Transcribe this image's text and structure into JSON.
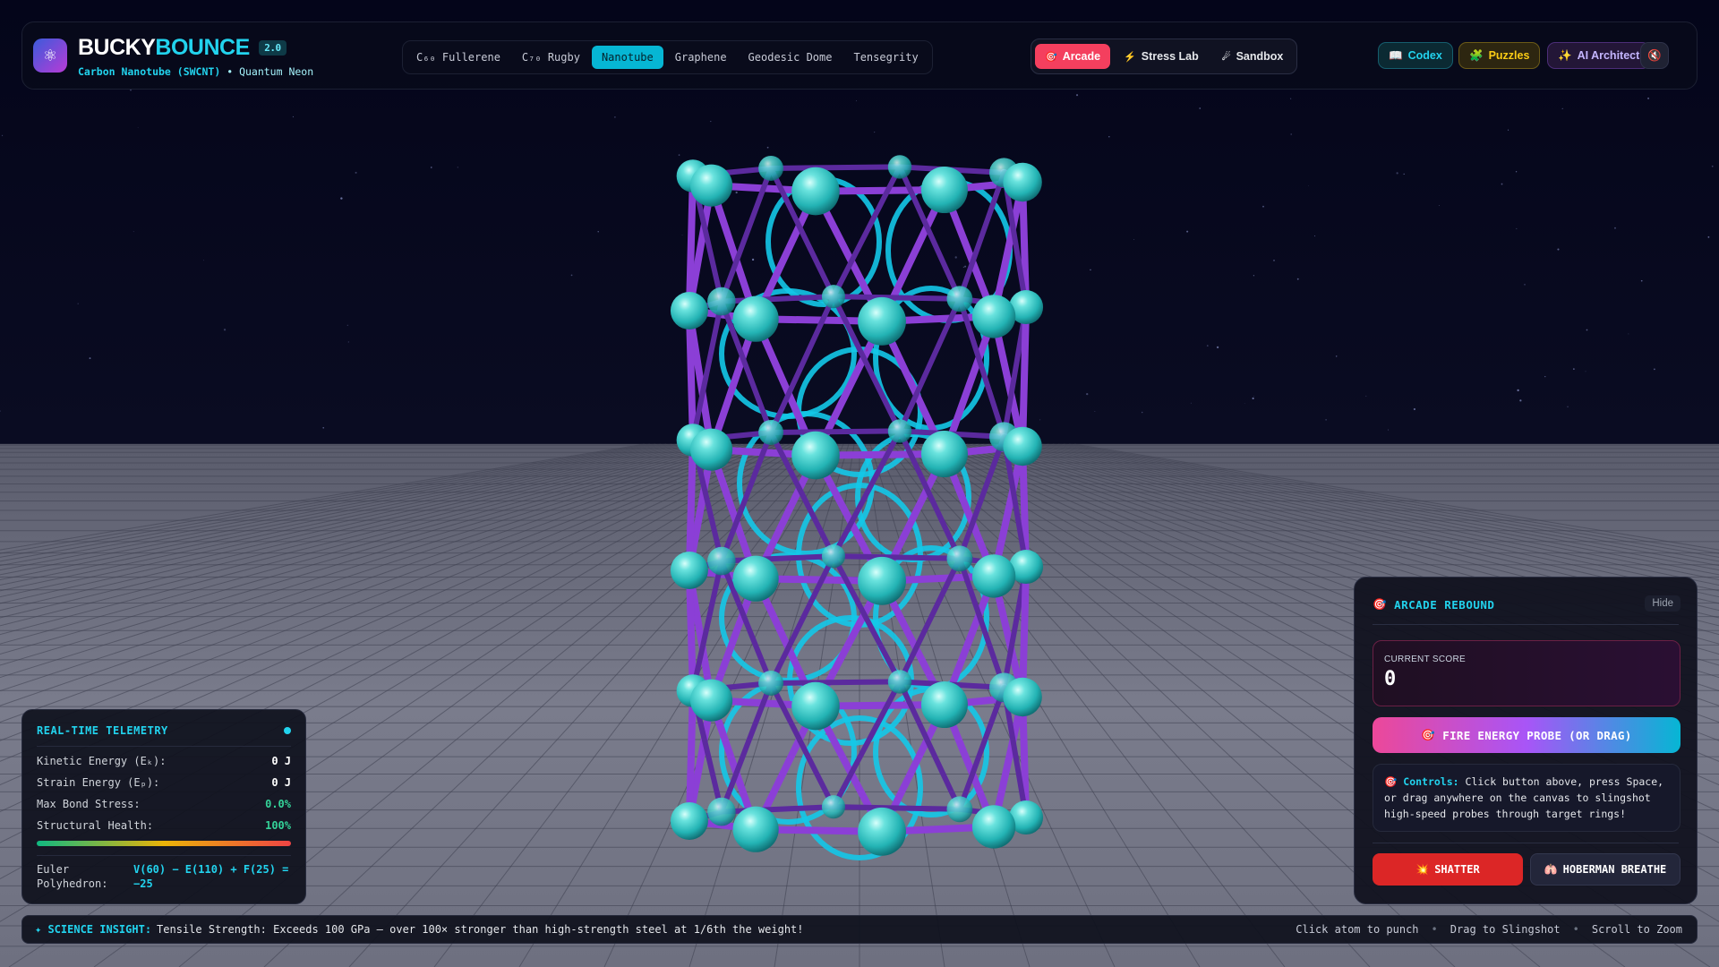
{
  "header": {
    "brand_part1": "BUCKY",
    "brand_part2": "BOUNCE",
    "version": "2.0",
    "subtitle_structure": "Carbon Nanotube (SWCNT)",
    "subtitle_separator": "•",
    "subtitle_theme": "Quantum Neon",
    "logo_icon": "atom-icon",
    "structure_tabs": [
      {
        "label": "C₆₀ Fullerene",
        "active": false
      },
      {
        "label": "C₇₀ Rugby",
        "active": false
      },
      {
        "label": "Nanotube",
        "active": true
      },
      {
        "label": "Graphene",
        "active": false
      },
      {
        "label": "Geodesic Dome",
        "active": false
      },
      {
        "label": "Tensegrity",
        "active": false
      }
    ],
    "modes": [
      {
        "label": "Arcade",
        "icon": "target-icon",
        "glyph": "🎯",
        "active": true
      },
      {
        "label": "Stress Lab",
        "icon": "lightning-icon",
        "glyph": "⚡",
        "active": false
      },
      {
        "label": "Sandbox",
        "icon": "comet-icon",
        "glyph": "☄",
        "active": false
      }
    ],
    "codex_label": "Codex",
    "codex_glyph": "📖",
    "puzzles_label": "Puzzles",
    "puzzles_glyph": "🧩",
    "ai_label": "AI Architect",
    "ai_glyph": "✨",
    "settings_icon": "mute-icon",
    "settings_glyph": "🔇"
  },
  "telemetry": {
    "title": "REAL-TIME TELEMETRY",
    "rows": [
      {
        "label": "Kinetic Energy (Eₖ):",
        "value": "0 J"
      },
      {
        "label": "Strain Energy (Eₚ):",
        "value": "0 J"
      },
      {
        "label": "Max Bond Stress:",
        "value": "0.0%"
      },
      {
        "label": "Structural Health:",
        "value": "100%"
      }
    ],
    "health_fraction": 1.0,
    "euler_label": "Euler Polyhedron:",
    "euler_value": "V(60) − E(110) + F(25) = −25"
  },
  "arcade": {
    "title": "ARCADE REBOUND",
    "title_glyph": "🎯",
    "hide_label": "Hide",
    "score_label": "CURRENT SCORE",
    "score_value": "0",
    "fire_label": "FIRE ENERGY PROBE (OR DRAG)",
    "fire_glyph": "🎯",
    "controls_key": "Controls:",
    "controls_glyph": "🎯",
    "controls_text": "Click button above, press Space, or drag anywhere on the canvas to slingshot high-speed probes through target rings!",
    "shatter_label": "SHATTER",
    "shatter_glyph": "💥",
    "breathe_label": "HOBERMAN BREATHE",
    "breathe_glyph": "🫁"
  },
  "footer": {
    "insight_tag": "✦ SCIENCE INSIGHT:",
    "insight_text": "Tensile Strength: Exceeds 100 GPa — over 100× stronger than high-strength steel at 1/6th the weight!",
    "hints": [
      "Click atom to punch",
      "Drag to Slingshot",
      "Scroll to Zoom"
    ]
  },
  "colors": {
    "accent": "#22d3ee",
    "atom": "#2cc7c9",
    "bond": "#8b3fd6",
    "ring": "#14c8e8",
    "sky": "#05061a",
    "floor": "#6a6c7c"
  }
}
